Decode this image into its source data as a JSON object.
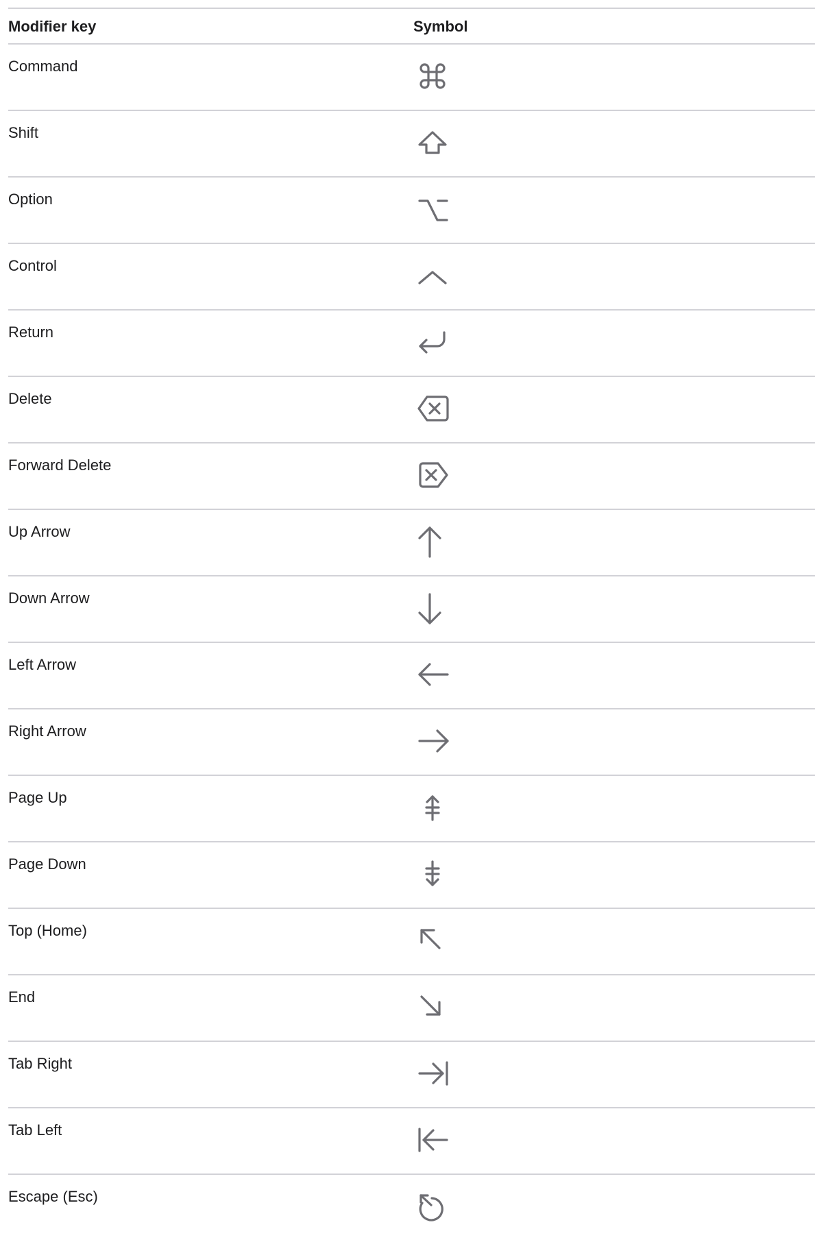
{
  "table": {
    "headers": {
      "key": "Modifier key",
      "symbol": "Symbol"
    },
    "rows": [
      {
        "key": "Command",
        "icon": "command-icon"
      },
      {
        "key": "Shift",
        "icon": "shift-icon"
      },
      {
        "key": "Option",
        "icon": "option-icon"
      },
      {
        "key": "Control",
        "icon": "control-icon"
      },
      {
        "key": "Return",
        "icon": "return-icon"
      },
      {
        "key": "Delete",
        "icon": "delete-icon"
      },
      {
        "key": "Forward Delete",
        "icon": "forward-delete-icon"
      },
      {
        "key": "Up Arrow",
        "icon": "up-arrow-icon"
      },
      {
        "key": "Down Arrow",
        "icon": "down-arrow-icon"
      },
      {
        "key": "Left Arrow",
        "icon": "left-arrow-icon"
      },
      {
        "key": "Right Arrow",
        "icon": "right-arrow-icon"
      },
      {
        "key": "Page Up",
        "icon": "page-up-icon"
      },
      {
        "key": "Page Down",
        "icon": "page-down-icon"
      },
      {
        "key": "Top (Home)",
        "icon": "top-home-icon"
      },
      {
        "key": "End",
        "icon": "end-icon"
      },
      {
        "key": "Tab Right",
        "icon": "tab-right-icon"
      },
      {
        "key": "Tab Left",
        "icon": "tab-left-icon"
      },
      {
        "key": "Escape (Esc)",
        "icon": "escape-icon"
      }
    ]
  },
  "colors": {
    "text": "#1d1d1f",
    "icon": "#6e6e73",
    "divider": "#d2d2d7"
  }
}
